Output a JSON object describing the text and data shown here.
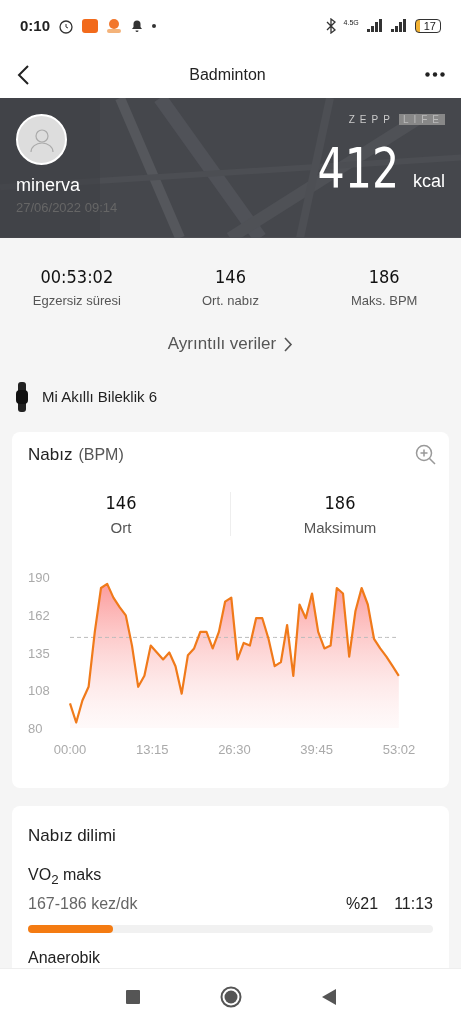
{
  "status_bar": {
    "time": "0:10",
    "network": "4.5G",
    "battery": "17"
  },
  "nav": {
    "title": "Badminton"
  },
  "header": {
    "logo": [
      "ZEPP",
      "LIFE"
    ],
    "user": "minerva",
    "date": "27/06/2022 09:14",
    "calories": "412",
    "unit": "kcal"
  },
  "stats": [
    {
      "value": "00:53:02",
      "label": "Egzersiz süresi"
    },
    {
      "value": "146",
      "label": "Ort. nabız"
    },
    {
      "value": "186",
      "label": "Maks. BPM"
    }
  ],
  "details_link": "Ayrıntılı veriler",
  "device": "Mi Akıllı Bileklik 6",
  "heart_rate": {
    "title": "Nabız",
    "unit": "(BPM)",
    "summary": [
      {
        "value": "146",
        "label": "Ort"
      },
      {
        "value": "186",
        "label": "Maksimum"
      }
    ],
    "chart_data": {
      "type": "area",
      "x": [
        0,
        1,
        2,
        3,
        4,
        5,
        6,
        7,
        8,
        9,
        10,
        11,
        12,
        13,
        14,
        15,
        16,
        17,
        18,
        19,
        20,
        21,
        22,
        23,
        24,
        25,
        26,
        27,
        28,
        29,
        30,
        31,
        32,
        33,
        34,
        35,
        36,
        37,
        38,
        39,
        40,
        41,
        42,
        43,
        44,
        45,
        46,
        47,
        48,
        49,
        50,
        51,
        52,
        53
      ],
      "series": [
        {
          "type": "area",
          "color": "#f07a1a",
          "values": [
            98,
            84,
            100,
            110,
            150,
            182,
            185,
            175,
            168,
            162,
            140,
            110,
            118,
            140,
            135,
            130,
            135,
            125,
            105,
            133,
            138,
            150,
            150,
            138,
            150,
            172,
            175,
            130,
            142,
            140,
            160,
            160,
            145,
            125,
            128,
            155,
            118,
            170,
            160,
            178,
            150,
            138,
            140,
            182,
            178,
            132,
            165,
            182,
            170,
            145,
            138,
            132,
            125,
            118
          ]
        },
        {
          "type": "line",
          "line_style": "dashed",
          "color": "#bbbbbb",
          "values": [
            146,
            146,
            146,
            146,
            146,
            146,
            146,
            146,
            146,
            146,
            146,
            146,
            146,
            146,
            146,
            146,
            146,
            146,
            146,
            146,
            146,
            146,
            146,
            146,
            146,
            146,
            146,
            146,
            146,
            146,
            146,
            146,
            146,
            146,
            146,
            146,
            146,
            146,
            146,
            146,
            146,
            146,
            146,
            146,
            146,
            146,
            146,
            146,
            146,
            146,
            146,
            146,
            146,
            146
          ]
        }
      ],
      "xlim": [
        0,
        53.03
      ],
      "ylim": [
        80,
        190
      ],
      "yticks": [
        80,
        108,
        135,
        162,
        190
      ],
      "xticks": [
        {
          "value": 0,
          "label": "00:00"
        },
        {
          "value": 13.25,
          "label": "13:15"
        },
        {
          "value": 26.5,
          "label": "26:30"
        },
        {
          "value": 39.75,
          "label": "39:45"
        },
        {
          "value": 53.03,
          "label": "53:02"
        }
      ],
      "stacked": false
    }
  },
  "zones": {
    "title": "Nabız dilimi",
    "items": [
      {
        "name": "VO$_{2}$ maks",
        "range": "167-186 kez/dk",
        "percent": "%21",
        "time": "11:13",
        "level": 0.21
      },
      {
        "name": "Anaerobik"
      }
    ]
  }
}
